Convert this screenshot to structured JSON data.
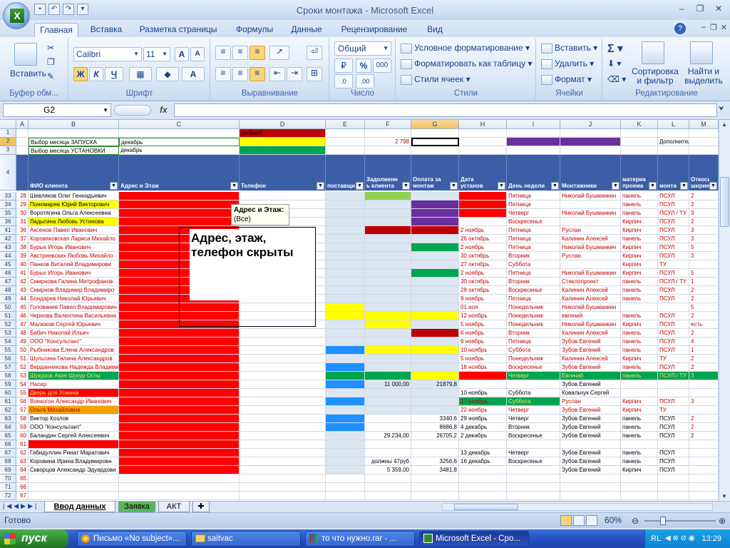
{
  "window": {
    "title": "Сроки монтажа - Microsoft Excel"
  },
  "tabs": [
    "Главная",
    "Вставка",
    "Разметка страницы",
    "Формулы",
    "Данные",
    "Рецензирование",
    "Вид"
  ],
  "ribbon": {
    "clipboard": {
      "label": "Буфер обм...",
      "paste": "Вставить"
    },
    "font": {
      "label": "Шрифт",
      "name": "Calibri",
      "size": "11",
      "bold": "Ж",
      "italic": "К",
      "underline": "Ч"
    },
    "alignment": {
      "label": "Выравнивание"
    },
    "number": {
      "label": "Число",
      "format": "Общий",
      "percent": "%",
      "thousands": "000"
    },
    "styles": {
      "label": "Стили",
      "conditional": "Условное форматирование",
      "table": "Форматировать как таблицу",
      "cell_styles": "Стили ячеек"
    },
    "cells": {
      "label": "Ячейки",
      "insert": "Вставить",
      "delete": "Удалить",
      "format": "Формат"
    },
    "editing": {
      "label": "Редактирование",
      "sort": "Сортировка и фильтр",
      "find": "Найти и выделить"
    }
  },
  "formula_bar": {
    "name_box": "G2",
    "fx": "fx",
    "value": ""
  },
  "columns": [
    "A",
    "B",
    "C",
    "D",
    "E",
    "F",
    "G",
    "H",
    "I",
    "J",
    "K",
    "L",
    "M"
  ],
  "top_rows": {
    "row1": {
      "num": "1",
      "D": "евгений"
    },
    "row2": {
      "num": "2",
      "B": "Выбор месяца ЗАПУСКА",
      "C": "декабрь",
      "F": "2 798",
      "L": "Дополнительно"
    },
    "row3": {
      "num": "3",
      "B": "Выбор месяца УСТАНОВКИ",
      "C": "декабрь"
    },
    "row4": {
      "num": "4"
    }
  },
  "headers": [
    "ФИО клиента",
    "Адрес и Этаж",
    "Телефон",
    "поставщи",
    "Задолженн ь клиента",
    "Оплата за монтаж",
    "Дата установ",
    "День недели",
    "Монтажники",
    "материа проема",
    "монта",
    "Откосы ширина"
  ],
  "rows": [
    {
      "r": "33",
      "a": "28",
      "b": "Шевляков Олег Геннадьевич",
      "h": "",
      "i": "Пятница",
      "j": "Николай Бушманкин",
      "k": "панель",
      "l": "ПСУЛ",
      "m": "2"
    },
    {
      "r": "34",
      "a": "29",
      "b": "Пономарев Юрий Викторович",
      "h": "",
      "i": "Пятница",
      "j": "",
      "k": "панель",
      "l": "ПСУЛ",
      "m": "2"
    },
    {
      "r": "35",
      "a": "30",
      "b": "Воротягина Ольга Алексеевна",
      "h": "",
      "i": "Четверг",
      "j": "Николай Бушманкин",
      "k": "панель",
      "l": "ПСУЛ / ТУ",
      "m": "3"
    },
    {
      "r": "36",
      "a": "31",
      "b": "Ладыгина Любовь Устинова",
      "h": "",
      "i": "Воскресенье",
      "j": "",
      "k": "Кирпич",
      "l": "ПСУЛ",
      "m": "2"
    },
    {
      "r": "41",
      "a": "36",
      "b": "Аксенов Павел Иванович",
      "h": "2 ноябрь",
      "i": "Пятница",
      "j": "Руслан",
      "k": "Кирпич",
      "l": "ПСУЛ",
      "m": "3"
    },
    {
      "r": "42",
      "a": "37",
      "b": "Коровяковская Лариса Михайло",
      "h": "26 октябрь",
      "i": "Пятница",
      "j": "Калинин Алексей",
      "k": "панель",
      "l": "ПСУЛ",
      "m": "3"
    },
    {
      "r": "43",
      "a": "38",
      "b": "Бурых Игорь Иванович",
      "h": "2 ноябрь",
      "i": "Пятница",
      "j": "Николай Бушманкин",
      "k": "Кирпич",
      "l": "ПСУЛ",
      "m": "5"
    },
    {
      "r": "44",
      "a": "39",
      "b": "Австриевских Любовь Михайло",
      "h": "30 октябрь",
      "i": "Вторник",
      "j": "Руслан",
      "k": "Кирпич",
      "l": "ПСУЛ",
      "m": "3"
    },
    {
      "r": "45",
      "a": "40",
      "b": "Панков Виталий Владимирови",
      "h": "27 октябрь",
      "i": "Суббота",
      "j": "",
      "k": "Кирпич",
      "l": "ТУ",
      "m": ""
    },
    {
      "r": "46",
      "a": "41",
      "b": "Бурых Игорь Иванович",
      "h": "2 ноябрь",
      "i": "Пятница",
      "j": "Николай Бушманкин",
      "k": "Кирпич",
      "l": "ПСУЛ",
      "m": "5"
    },
    {
      "r": "47",
      "a": "42",
      "b": "Смирнова Галина Митрофанов",
      "h": "30 октябрь",
      "i": "Вторник",
      "j": "Стеклопроект",
      "k": "панель",
      "l": "ПСУЛ / ТУ",
      "m": "1"
    },
    {
      "r": "48",
      "a": "43",
      "b": "Смирнов Владимир Владимиро",
      "h": "28 октябрь",
      "i": "Воскресенье",
      "j": "Калинин Алексей",
      "k": "панель",
      "l": "ПСУЛ",
      "m": "2"
    },
    {
      "r": "49",
      "a": "44",
      "b": "Бондарев Николай Юрьевич",
      "h": "9 ноябрь",
      "i": "Пятница",
      "j": "Калинин Алексей",
      "k": "панель",
      "l": "ПСУЛ",
      "m": "2"
    },
    {
      "r": "50",
      "a": "45",
      "b": "Голованев Павел Владимирович",
      "h": "01.ноя",
      "i": "Понедельник",
      "j": "Николай Бушманкин",
      "k": "",
      "l": "",
      "m": "5"
    },
    {
      "r": "51",
      "a": "46",
      "b": "Чернова Валентина Васильевна",
      "h": "12 ноябрь",
      "i": "Понедельник",
      "j": "евгений",
      "k": "панель",
      "l": "ПСУЛ",
      "m": "2"
    },
    {
      "r": "52",
      "a": "47",
      "b": "Малюков Сергей Юрьевич",
      "h": "5 ноябрь",
      "i": "Понедельник",
      "j": "Николай Бушманкин",
      "k": "Кирпич",
      "l": "ПСУЛ",
      "m": "есть"
    },
    {
      "r": "53",
      "a": "48",
      "b": "Бабич Николай Ильич",
      "h": "6 ноябрь",
      "i": "Вторник",
      "j": "Калинин Алексей",
      "k": "панель",
      "l": "ПСУЛ",
      "m": "2"
    },
    {
      "r": "54",
      "a": "49",
      "b": "ООО \"Консультант\"",
      "h": "9 ноябрь",
      "i": "Пятница",
      "j": "Зубов Евгений",
      "k": "панель",
      "l": "ПСУЛ",
      "m": "4"
    },
    {
      "r": "55",
      "a": "50",
      "b": "Рыбникова Елена Александров",
      "h": "10 ноябрь",
      "i": "Суббота",
      "j": "Зубов Евгений",
      "k": "панель",
      "l": "ПСУЛ",
      "m": "1"
    },
    {
      "r": "56",
      "a": "51",
      "b": "Шульгина Галина Александров",
      "h": "5 ноябрь",
      "i": "Понедельник",
      "j": "Калинин Алексей",
      "k": "Кирпич",
      "l": "ТУ",
      "m": "2"
    },
    {
      "r": "57",
      "a": "52",
      "b": "Верданникова Надежда Владими",
      "h": "18 ноябрь",
      "i": "Воскресенье",
      "j": "Зубов Евгений",
      "k": "панель",
      "l": "ПСУЛ",
      "m": "2"
    },
    {
      "r": "58",
      "a": "53",
      "b": "Шукуров Акия Шукур Оглы",
      "h": "",
      "i": "Четверг",
      "j": "Евгений",
      "k": "панель",
      "l": "ПСУЛ / ТУ",
      "m": "3"
    },
    {
      "r": "59",
      "a": "54",
      "b": "Насир",
      "f": "11 000,00",
      "g": "21879,8",
      "h": "",
      "i": "",
      "j": "Зубов Евгений",
      "k": "",
      "l": "",
      "m": ""
    },
    {
      "r": "60",
      "a": "55",
      "b": "Дверь для Усмана",
      "h": "10 ноябрь",
      "i": "Суббота",
      "j": "Ковальчук Сергей",
      "k": "",
      "l": "",
      "m": ""
    },
    {
      "r": "61",
      "a": "56",
      "b": "Воекогон Александр Иванович",
      "h": "17 ноябрь",
      "i": "Суббота",
      "j": "Руслан",
      "k": "Кирпич",
      "l": "ПСУЛ",
      "m": "3"
    },
    {
      "r": "62",
      "a": "57",
      "b": "Ольга Михайловна",
      "h": "22 ноябрь",
      "i": "Четверг",
      "j": "Зубов Евгений",
      "k": "Кирпич",
      "l": "ТУ",
      "m": ""
    },
    {
      "r": "63",
      "a": "58",
      "b": "Виктор Козлов",
      "g": "3340,6",
      "h": "29 ноябрь",
      "i": "Четверг",
      "j": "Зубов Евгений",
      "k": "панель",
      "l": "ПСУЛ",
      "m": "2"
    },
    {
      "r": "64",
      "a": "59",
      "b": "ООО \"Консультант\"",
      "g": "8686,8",
      "h": "4 декабрь",
      "i": "Вторник",
      "j": "Зубов Евгений",
      "k": "панель",
      "l": "ПСУЛ",
      "m": "2"
    },
    {
      "r": "65",
      "a": "60",
      "b": "Баландин Сергей Алексеевич",
      "f": "29 234,00",
      "g": "26705,2",
      "h": "2 декабрь",
      "i": "Воскресенье",
      "j": "Зубов Евгений",
      "k": "панель",
      "l": "ПСУЛ",
      "m": "2"
    },
    {
      "r": "66",
      "a": "61",
      "b": "",
      "h": "",
      "i": "",
      "j": "",
      "k": "",
      "l": "",
      "m": ""
    },
    {
      "r": "67",
      "a": "62",
      "b": "Габидуллин Ринат Маратович",
      "h": "13 декабрь",
      "i": "Четверг",
      "j": "Зубов Евгений",
      "k": "панель",
      "l": "ПСУЛ",
      "m": ""
    },
    {
      "r": "68",
      "a": "63",
      "b": "Коровина Ирина Владимировн",
      "f": "должны 47руб",
      "g": "3256,6",
      "h": "16 декабрь",
      "i": "Воскресенье",
      "j": "Зубов Евгений",
      "k": "панель",
      "l": "ПСУЛ",
      "m": ""
    },
    {
      "r": "69",
      "a": "64",
      "b": "Скворцов Александр Эдуардови",
      "f": "5 359,00",
      "g": "3481,8",
      "h": "",
      "i": "",
      "j": "Зубов Евгений",
      "k": "Кирпич",
      "l": "ПСУЛ",
      "m": ""
    },
    {
      "r": "70",
      "a": "65",
      "b": "",
      "h": "",
      "i": "",
      "j": "",
      "k": "",
      "l": "",
      "m": ""
    },
    {
      "r": "71",
      "a": "66",
      "b": "",
      "h": "",
      "i": "",
      "j": "",
      "k": "",
      "l": "",
      "m": ""
    },
    {
      "r": "72",
      "a": "67",
      "b": "",
      "h": "",
      "i": "",
      "j": "",
      "k": "",
      "l": "",
      "m": ""
    }
  ],
  "comment": {
    "text": "Адрес, этаж, телефон скрыты"
  },
  "tooltip": {
    "title": "Адрес и Этаж:",
    "value": "(Все)"
  },
  "sheet_tabs": [
    "Ввод данных",
    "Заявка",
    "АКТ"
  ],
  "status": {
    "ready": "Готово",
    "zoom": "60%"
  },
  "taskbar": {
    "start": "пуск",
    "items": [
      "Письмо «No subject»...",
      "saitvac",
      "то что нужно.rar - ...",
      "Microsoft Excel - Сро..."
    ],
    "lang": "RL",
    "clock": "13:29"
  }
}
